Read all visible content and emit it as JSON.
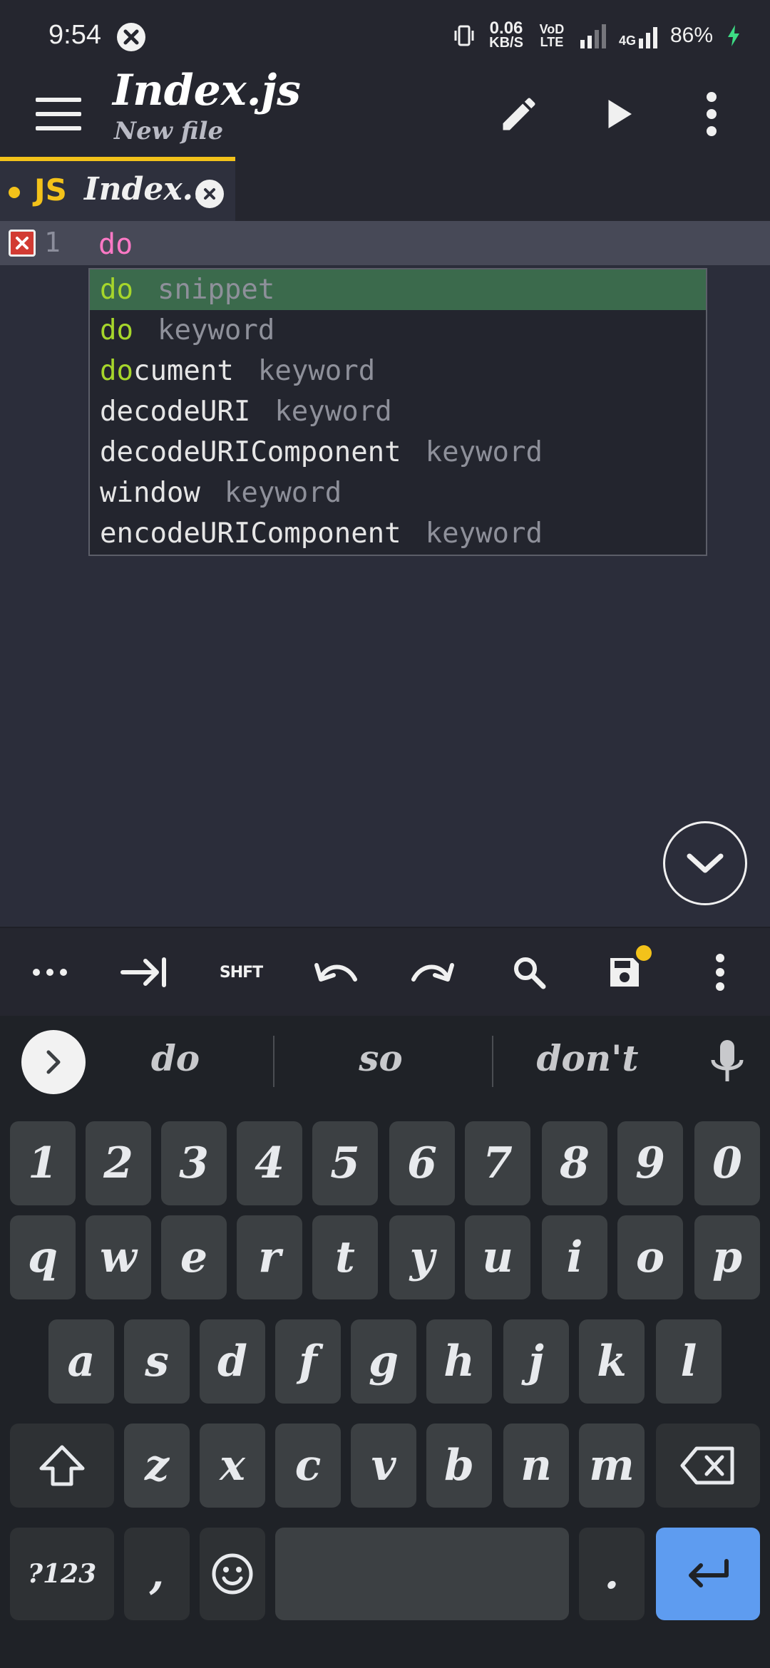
{
  "status": {
    "time": "9:54",
    "net_speed_value": "0.06",
    "net_speed_unit": "KB/S",
    "vol_lte": "VoD LTE",
    "network": "4G",
    "battery": "86%"
  },
  "appbar": {
    "title": "Index.js",
    "subtitle": "New file"
  },
  "tab": {
    "badge": "JS",
    "label": "Index..."
  },
  "editor": {
    "line_number": "1",
    "code": "do"
  },
  "autocomplete": [
    {
      "match": "do",
      "rest": "",
      "kind": "snippet",
      "selected": true
    },
    {
      "match": "do",
      "rest": "",
      "kind": "keyword",
      "selected": false
    },
    {
      "match": "do",
      "rest": "cument",
      "kind": "keyword",
      "selected": false
    },
    {
      "match": "",
      "rest": "decodeURI",
      "kind": "keyword",
      "selected": false
    },
    {
      "match": "",
      "rest": "decodeURIComponent",
      "kind": "keyword",
      "selected": false
    },
    {
      "match": "",
      "rest": "window",
      "kind": "keyword",
      "selected": false
    },
    {
      "match": "",
      "rest": "encodeURIComponent",
      "kind": "keyword",
      "selected": false
    }
  ],
  "toolbar": {
    "shift_label": "SHFT"
  },
  "keyboard": {
    "suggestions": [
      "do",
      "so",
      "don't"
    ],
    "row_numbers": [
      "1",
      "2",
      "3",
      "4",
      "5",
      "6",
      "7",
      "8",
      "9",
      "0"
    ],
    "row1": [
      "q",
      "w",
      "e",
      "r",
      "t",
      "y",
      "u",
      "i",
      "o",
      "p"
    ],
    "row2": [
      "a",
      "s",
      "d",
      "f",
      "g",
      "h",
      "j",
      "k",
      "l"
    ],
    "row3": [
      "z",
      "x",
      "c",
      "v",
      "b",
      "n",
      "m"
    ],
    "symbols_label": "?123",
    "comma": ",",
    "period": "."
  }
}
